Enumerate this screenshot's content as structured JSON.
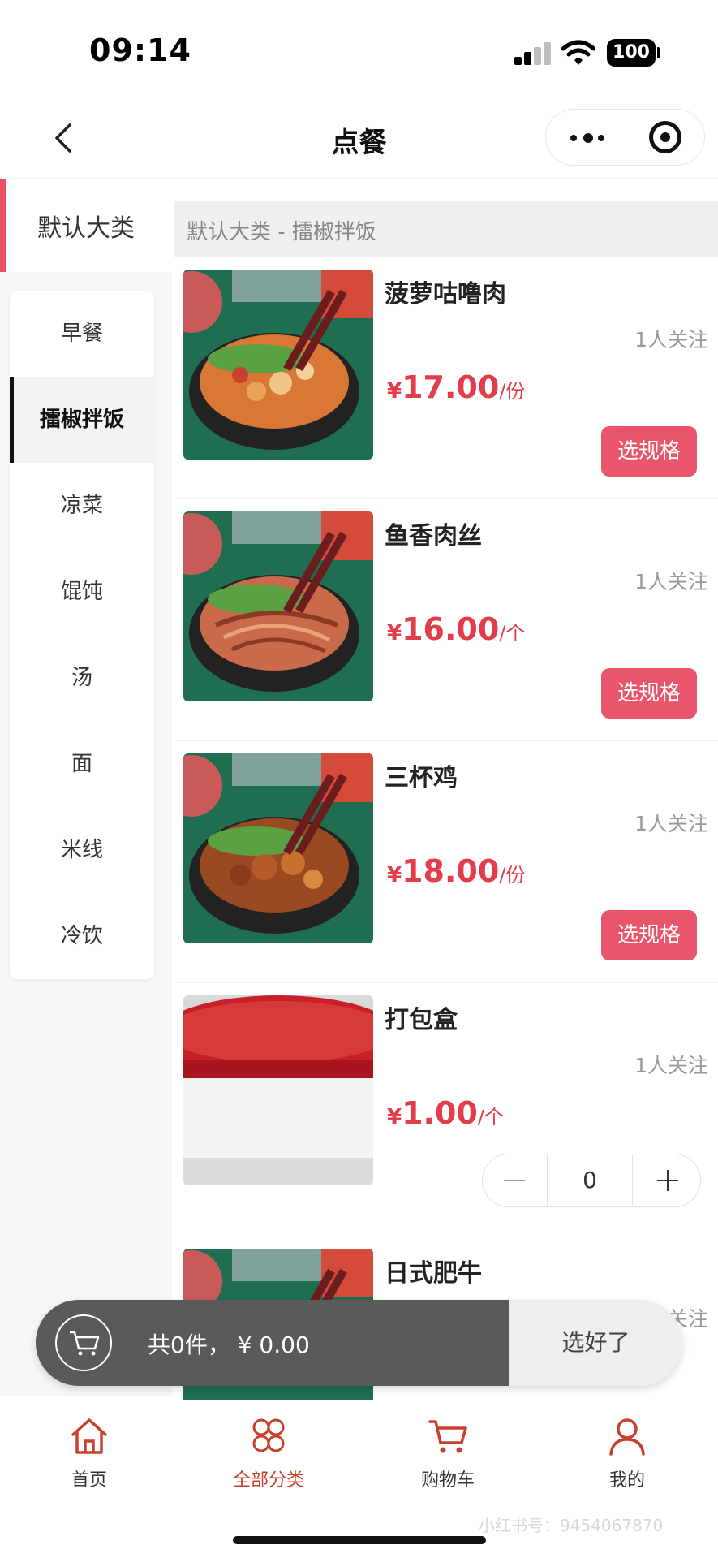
{
  "status_bar": {
    "time": "09:14",
    "battery": "100"
  },
  "nav": {
    "title": "点餐"
  },
  "sidebar": {
    "category": "默认大类",
    "items": [
      {
        "label": "早餐"
      },
      {
        "label": "擂椒拌饭",
        "active": true
      },
      {
        "label": "凉菜"
      },
      {
        "label": "馄饨"
      },
      {
        "label": "汤"
      },
      {
        "label": "面"
      },
      {
        "label": "米线"
      },
      {
        "label": "冷饮"
      }
    ]
  },
  "breadcrumb": "默认大类 - 擂椒拌饭",
  "products": [
    {
      "name": "菠萝咕噜肉",
      "follow": "1人关注",
      "currency": "¥",
      "price": "17.00",
      "unit": "/份",
      "action": "选规格"
    },
    {
      "name": "鱼香肉丝",
      "follow": "1人关注",
      "currency": "¥",
      "price": "16.00",
      "unit": "/个",
      "action": "选规格"
    },
    {
      "name": "三杯鸡",
      "follow": "1人关注",
      "currency": "¥",
      "price": "18.00",
      "unit": "/份",
      "action": "选规格"
    },
    {
      "name": "打包盒",
      "follow": "1人关注",
      "currency": "¥",
      "price": "1.00",
      "unit": "/个",
      "quantity": "0"
    },
    {
      "name": "日式肥牛",
      "follow": "1人关注"
    }
  ],
  "cart": {
    "summary": "共0件，  ¥ 0.00",
    "confirm": "选好了"
  },
  "tabs": [
    {
      "label": "首页",
      "icon": "home-icon"
    },
    {
      "label": "全部分类",
      "icon": "categories-icon",
      "active": true
    },
    {
      "label": "购物车",
      "icon": "cart-icon"
    },
    {
      "label": "我的",
      "icon": "user-icon"
    }
  ],
  "watermark": "小红书号：9454067870",
  "colors": {
    "accent": "#e9556a",
    "price": "#e23d4a",
    "tab_active": "#c8402e",
    "cart_bar": "#5a5a5a"
  }
}
